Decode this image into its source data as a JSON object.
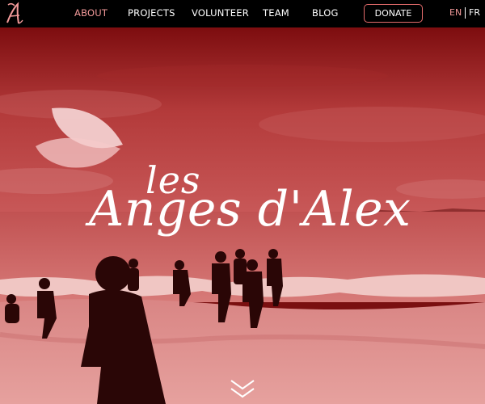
{
  "nav": {
    "items": [
      {
        "label": "ABOUT",
        "active": true
      },
      {
        "label": "PROJECTS",
        "active": false
      },
      {
        "label": "VOLUNTEER",
        "active": false
      },
      {
        "label": "TEAM",
        "active": false
      },
      {
        "label": "BLOG",
        "active": false
      }
    ],
    "donate_label": "DONATE",
    "lang_en": "EN",
    "lang_fr": "FR"
  },
  "hero": {
    "title_line1": "les",
    "title_line2": "Anges d'Alex"
  },
  "icons": {
    "logo": "angel-a-logo-icon",
    "wings": "wing-icon",
    "scroll": "double-chevron-down-icon"
  },
  "colors": {
    "nav_bg": "#000000",
    "accent": "#e46b6b",
    "active_link": "#f39a9a",
    "hero_tint": "#8c1414"
  }
}
